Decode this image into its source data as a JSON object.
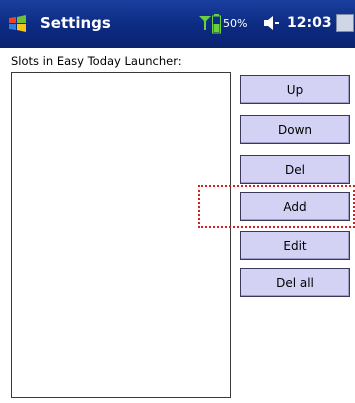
{
  "titlebar": {
    "title": "Settings",
    "battery": "50%",
    "time": "12:03",
    "icons": [
      "windows-start-icon",
      "signal-icon",
      "battery-icon",
      "volume-icon",
      "close-icon"
    ]
  },
  "content": {
    "list_label": "Slots in Easy Today Launcher:",
    "slots": []
  },
  "buttons": {
    "up": "Up",
    "down": "Down",
    "del": "Del",
    "add": "Add",
    "edit": "Edit",
    "del_all": "Del all"
  },
  "colors": {
    "titlebar": "#0c2a82",
    "button_face": "#d4d2f4",
    "highlight": "#d71e1e"
  }
}
